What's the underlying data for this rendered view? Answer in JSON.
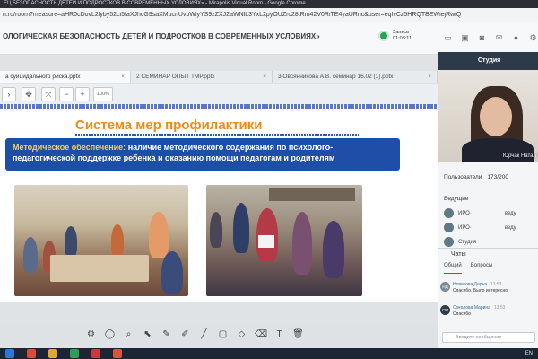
{
  "browser": {
    "title": "ЕЦ БЕЗОПАСНОСТЬ ДЕТЕЙ И ПОДРОСТКОВ В СОВРЕМЕННЫХ УСЛОВИЯХ» - Mirapolis Virtual Room - Google Chrome",
    "url": "n.ru/room?measure=aHR0cDovL2lyby52ci5taXJhcG9saXMucnUvbWlyYS9zZXJ2aWNlL3YxL2pyOUZrc28tRm42V0RiTE4yaURnc&user=eqfvCz5HRQTBEWiejRwiQ"
  },
  "app": {
    "event_title": "ОЛОГИЧЕСКАЯ БЕЗОПАСНОСТЬ ДЕТЕЙ И ПОДРОСТКОВ В СОВРЕМЕННЫХ УСЛОВИЯХ»",
    "record_label": "Запись",
    "record_time": "01:03:11",
    "header_icons": [
      "chat-bubble-icon",
      "monitor-icon",
      "camera-icon",
      "mail-icon",
      "person-icon",
      "settings-icon"
    ]
  },
  "tabs": [
    {
      "label": "а суицидального риска.pptx",
      "close": "×"
    },
    {
      "label": "2 СЕМИНАР ОПЫТ ТМР.pptx",
      "close": "×"
    },
    {
      "label": "3 Овсянникова А.В. семинар 16.02 (1).pptx",
      "close": "×"
    }
  ],
  "slide_toolbar": {
    "zoom": "100%"
  },
  "slide": {
    "title": "Система мер профилактики",
    "lead": "Методическое обеспечение:",
    "body": "наличие методического содержания по психолого-педагогической поддержке ребенка и оказанию помощи педагогам и родителям"
  },
  "studio": {
    "header": "Студия",
    "camera_name": "Юрчак Натал"
  },
  "users": {
    "label": "Пользователи",
    "count": "173/200",
    "hosts_label": "Ведущие",
    "items": [
      {
        "name": "ИРО·",
        "role": "веду"
      },
      {
        "name": "ИРО·",
        "role": "веду"
      },
      {
        "name": "Студия",
        "role": ""
      }
    ]
  },
  "chat": {
    "header": "Чаты",
    "tabs": [
      "Общий",
      "Вопросы"
    ],
    "messages": [
      {
        "initials": "НД",
        "author": "Новикова Дарья",
        "time": "13:53",
        "text": "Спасибо. Было интересно"
      },
      {
        "initials": "СМ",
        "author": "Соколова Марина",
        "time": "13:53",
        "text": "Спасибо"
      }
    ],
    "input_placeholder": "Введите сообщение"
  },
  "taskbar": {
    "lang": "EN"
  },
  "colors": {
    "title_orange": "#f08a18",
    "box_blue": "#1d4fa8",
    "record_green": "#2e9e52",
    "studio_header": "#2c3a4a"
  }
}
